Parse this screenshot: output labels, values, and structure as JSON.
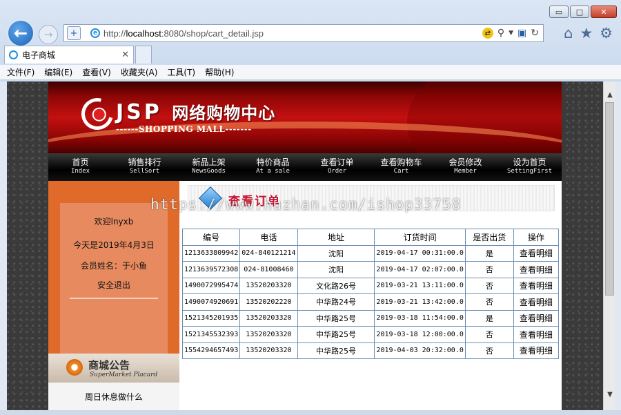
{
  "browser": {
    "url_prefix": "http://",
    "url_host": "localhost",
    "url_rest": ":8080/shop/cart_detail.jsp",
    "tab_title": "电子商城",
    "window_controls": {
      "minimize": "▭",
      "maximize": "□",
      "close": "✕"
    },
    "icons": [
      "back-arrow-icon",
      "forward-arrow-icon",
      "shield-icon",
      "ie-logo-icon",
      "search-icon",
      "refresh-icon",
      "home-icon",
      "favorites-star-icon",
      "settings-gear-icon"
    ],
    "menu": [
      "文件(F)",
      "编辑(E)",
      "查看(V)",
      "收藏夹(A)",
      "工具(T)",
      "帮助(H)"
    ]
  },
  "site": {
    "logo_text": "JSP",
    "logo_cn": "网络购物中心",
    "logo_sub": "------SHOPPING MALL-------",
    "nav": [
      {
        "cn": "首页",
        "en": "Index"
      },
      {
        "cn": "销售排行",
        "en": "SellSort"
      },
      {
        "cn": "新品上架",
        "en": "NewsGoods"
      },
      {
        "cn": "特价商品",
        "en": "At a sale"
      },
      {
        "cn": "查看订单",
        "en": "Order"
      },
      {
        "cn": "查看购物车",
        "en": "Cart"
      },
      {
        "cn": "会员修改",
        "en": "Member"
      },
      {
        "cn": "设为首页",
        "en": "SettingFirst"
      }
    ],
    "sidebar": {
      "welcome": "欢迎lnyxb",
      "date": "今天是2019年4月3日",
      "member_name": "会员姓名：于小鱼",
      "logout": "安全退出"
    },
    "notice": {
      "title": "商城公告",
      "subtitle": "SuperMarket Placard",
      "text": "周日休息做什么"
    },
    "content": {
      "title": "查看订单",
      "headers": [
        "编号",
        "电话",
        "地址",
        "订货时间",
        "是否出货",
        "操作"
      ],
      "rows": [
        [
          "1213633809942",
          "024-840121214",
          "沈阳",
          "2019-04-17 00:31:00.0",
          "是",
          "查看明细"
        ],
        [
          "1213639572308",
          "024-81008460",
          "沈阳",
          "2019-04-17 02:07:00.0",
          "否",
          "查看明细"
        ],
        [
          "1490072995474",
          "13520203320",
          "文化路26号",
          "2019-03-21 13:11:00.0",
          "否",
          "查看明细"
        ],
        [
          "1490074920691",
          "13520202220",
          "中华路24号",
          "2019-03-21 13:42:00.0",
          "否",
          "查看明细"
        ],
        [
          "1521345201935",
          "13520203320",
          "中华路25号",
          "2019-03-18 11:54:00.0",
          "是",
          "查看明细"
        ],
        [
          "1521345532393",
          "13520203320",
          "中华路25号",
          "2019-03-18 12:00:00.0",
          "否",
          "查看明细"
        ],
        [
          "1554294657493",
          "13520203320",
          "中华路25号",
          "2019-04-03 20:32:00.0",
          "否",
          "查看明细"
        ]
      ]
    },
    "watermark": "https://www.huzhan.com/ishop33758"
  }
}
